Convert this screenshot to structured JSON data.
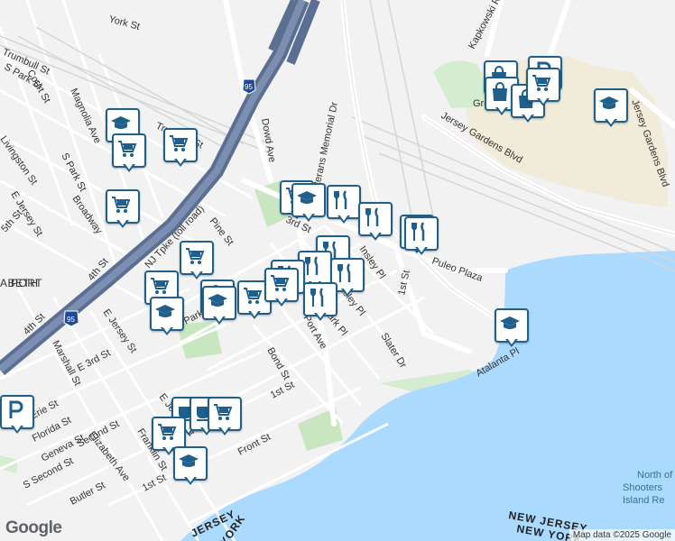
{
  "map": {
    "streets": [
      {
        "name": "York St"
      },
      {
        "name": "Kapkowski Rd"
      },
      {
        "name": "Trumbull St"
      },
      {
        "name": "Court St"
      },
      {
        "name": "S Park St"
      },
      {
        "name": "Magnolia Ave"
      },
      {
        "name": "Livingston St"
      },
      {
        "name": "S Park St"
      },
      {
        "name": "Broadway"
      },
      {
        "name": "E Jersey St"
      },
      {
        "name": "5th St"
      },
      {
        "name": "4th St"
      },
      {
        "name": "4th St"
      },
      {
        "name": "NJ Tpke (toll road)"
      },
      {
        "name": "Dowd Ave"
      },
      {
        "name": "Veterans Memorial Dr"
      },
      {
        "name": "Jersey Gardens Blvd"
      },
      {
        "name": "Jersey Gardens Blvd"
      },
      {
        "name": "Pine St"
      },
      {
        "name": "3rd St"
      },
      {
        "name": "Puleo Plaza"
      },
      {
        "name": "1st St"
      },
      {
        "name": "Slater Dr"
      },
      {
        "name": "Atalanta Pl"
      },
      {
        "name": "Insley Pl"
      },
      {
        "name": "Insley Pl"
      },
      {
        "name": "Park Pl"
      },
      {
        "name": "Port Ave"
      },
      {
        "name": "Bond St"
      },
      {
        "name": "1st St"
      },
      {
        "name": "Front St"
      },
      {
        "name": "E Jersey St"
      },
      {
        "name": "Marshall St"
      },
      {
        "name": "E 3rd St"
      },
      {
        "name": "E Jersey St"
      },
      {
        "name": "Second St"
      },
      {
        "name": "Erie St"
      },
      {
        "name": "Florida St"
      },
      {
        "name": "Geneva St"
      },
      {
        "name": "S Second St"
      },
      {
        "name": "Butler St"
      },
      {
        "name": "Elizabeth Ave"
      },
      {
        "name": "Franklin St"
      },
      {
        "name": "1st St"
      },
      {
        "name": "Trumbull St"
      },
      {
        "name": "Park Pl"
      }
    ],
    "area_label": "PORT",
    "area_label_prefix": "ABETH",
    "highway_shield": "95",
    "highway_shield_2": "95",
    "water_labels": [
      "North of",
      "Shooters",
      "Island Re"
    ],
    "state_labels": [
      "NEW JERSEY",
      "NEW YORK",
      "JERSEY",
      "YORK"
    ],
    "park_label": "Gre",
    "logo": "Google",
    "attribution": "Map data ©2025 Google"
  },
  "pins": [
    {
      "icon": "education-icon"
    },
    {
      "icon": "shopping-cart-icon"
    },
    {
      "icon": "shopping-cart-icon"
    },
    {
      "icon": "shopping-cart-icon"
    },
    {
      "icon": "shopping-cart-icon"
    },
    {
      "icon": "shopping-cart-icon"
    },
    {
      "icon": "education-icon"
    },
    {
      "icon": "restaurant-icon"
    },
    {
      "icon": "restaurant-icon"
    },
    {
      "icon": "restaurant-icon"
    },
    {
      "icon": "restaurant-icon"
    },
    {
      "icon": "restaurant-icon"
    },
    {
      "icon": "restaurant-icon"
    },
    {
      "icon": "restaurant-icon"
    },
    {
      "icon": "restaurant-icon"
    },
    {
      "icon": "restaurant-icon"
    },
    {
      "icon": "shopping-cart-icon"
    },
    {
      "icon": "shopping-cart-icon"
    },
    {
      "icon": "shopping-cart-icon"
    },
    {
      "icon": "shopping-bag-icon"
    },
    {
      "icon": "education-icon"
    },
    {
      "icon": "education-icon"
    },
    {
      "icon": "education-icon"
    },
    {
      "icon": "shopping-bag-icon"
    },
    {
      "icon": "shopping-bag-icon"
    },
    {
      "icon": "shopping-bag-icon"
    },
    {
      "icon": "parking-icon"
    },
    {
      "icon": "education-icon"
    },
    {
      "icon": "shopping-cart-icon"
    },
    {
      "icon": "parking-icon"
    },
    {
      "icon": "cafe-icon"
    },
    {
      "icon": "cafe-icon"
    },
    {
      "icon": "shopping-cart-icon"
    },
    {
      "icon": "shopping-cart-icon"
    },
    {
      "icon": "education-icon"
    }
  ]
}
